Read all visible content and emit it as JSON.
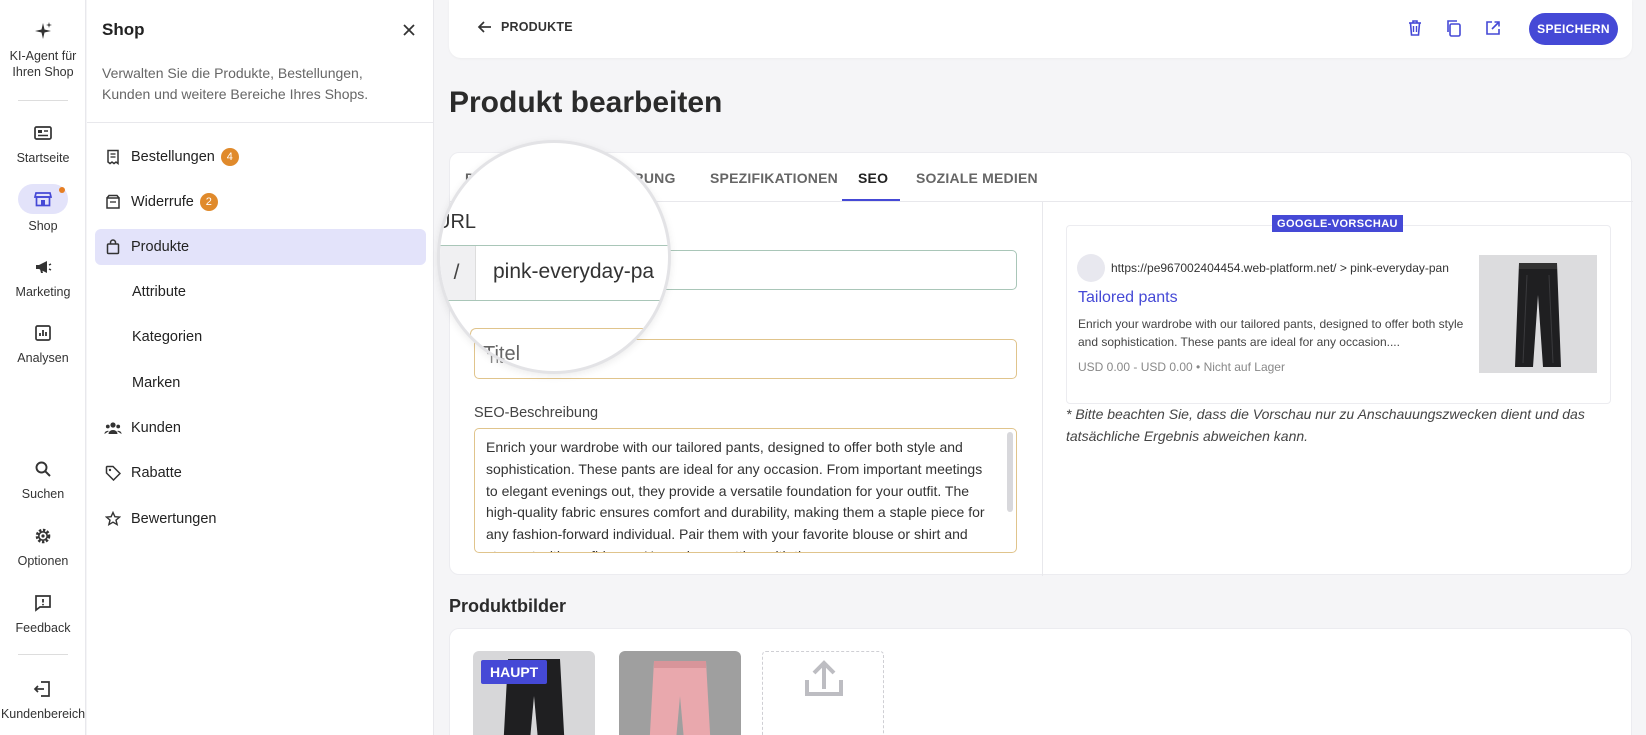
{
  "rail": {
    "items": [
      {
        "label": "KI-Agent für Ihren Shop",
        "icon": "sparkle-icon"
      },
      {
        "label": "Startseite",
        "icon": "dashboard-icon"
      },
      {
        "label": "Shop",
        "icon": "store-icon"
      },
      {
        "label": "Marketing",
        "icon": "megaphone-icon"
      },
      {
        "label": "Analysen",
        "icon": "chart-icon"
      },
      {
        "label": "Suchen",
        "icon": "search-icon"
      },
      {
        "label": "Optionen",
        "icon": "gear-icon"
      },
      {
        "label": "Feedback",
        "icon": "feedback-icon"
      },
      {
        "label": "Kundenbereich",
        "icon": "logout-icon"
      }
    ]
  },
  "panel": {
    "title": "Shop",
    "description": "Verwalten Sie die Produkte, Bestellungen, Kunden und weitere Bereiche Ihres Shops.",
    "items": [
      {
        "label": "Bestellungen",
        "badge": "4"
      },
      {
        "label": "Widerrufe",
        "badge": "2"
      },
      {
        "label": "Produkte"
      },
      {
        "label": "Attribute"
      },
      {
        "label": "Kategorien"
      },
      {
        "label": "Marken"
      },
      {
        "label": "Kunden"
      },
      {
        "label": "Rabatte"
      },
      {
        "label": "Bewertungen"
      }
    ]
  },
  "topbar": {
    "back_label": "PRODUKTE",
    "save_label": "SPEICHERN"
  },
  "page": {
    "title": "Produkt bearbeiten"
  },
  "tabs": {
    "items": [
      "D",
      "ERUNG",
      "SPEZIFIKATIONEN",
      "SEO",
      "SOZIALE MEDIEN"
    ],
    "active": "SEO"
  },
  "seo": {
    "url_label": "URL",
    "url_prefix": "/",
    "url_value": "pink-everyday-pa",
    "title_placeholder": "Titel",
    "description_label": "SEO-Beschreibung",
    "description_value": "Enrich your wardrobe with our tailored pants, designed to offer both style and sophistication. These pants are ideal for any occasion. From important meetings to elegant evenings out, they provide a versatile foundation for your outfit. The high-quality fabric ensures comfort and durability, making them a staple piece for any fashion-forward individual. Pair them with your favorite blouse or shirt and step out with confidence. Here, dress setting with the"
  },
  "google_preview": {
    "label": "GOOGLE-VORSCHAU",
    "url": "https://pe967002404454.web-platform.net/ > pink-everyday-pan",
    "title": "Tailored pants",
    "description": "Enrich your wardrobe with our tailored pants, designed to offer both style and sophistication. These pants are ideal for any occasion....",
    "price": "USD 0.00 - USD 0.00 • Nicht auf Lager",
    "note": "* Bitte beachten Sie, dass die Vorschau nur zu Anschauungszwecken dient und das tatsächliche Ergebnis abweichen kann."
  },
  "images": {
    "title": "Produktbilder",
    "main_badge": "HAUPT"
  },
  "colors": {
    "accent": "#4549d6",
    "badge": "#e08a2b",
    "active_bg": "#e3e3fa"
  }
}
